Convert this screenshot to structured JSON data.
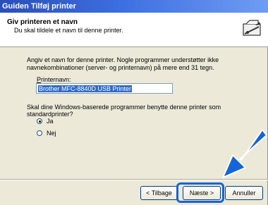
{
  "window": {
    "title": "Guiden Tilføj printer"
  },
  "header": {
    "title": "Giv printeren et navn",
    "subtitle": "Du skal tildele et navn til denne printer.",
    "icon": "printer-wizard-icon"
  },
  "body": {
    "instructions": "Angiv et navn for denne printer. Nogle programmer understøtter ikke navnekombinationer (server- og printernavn) på mere end 31 tegn.",
    "field_label_prefix": "P",
    "field_label_rest": "rinternavn:",
    "printer_name_value": "Brother MFC-8840D USB Printer",
    "question": "Skal dine Windows-baserede programmer benytte denne printer som standardprinter?",
    "option_yes": "Ja",
    "option_no": "Nej",
    "selected_option": "Ja"
  },
  "buttons": {
    "back": "< Tilbage",
    "next": "Næste >",
    "cancel": "Annuller"
  },
  "annotation": {
    "arrow_color": "#1565d8",
    "highlight_color": "#1565d8"
  }
}
